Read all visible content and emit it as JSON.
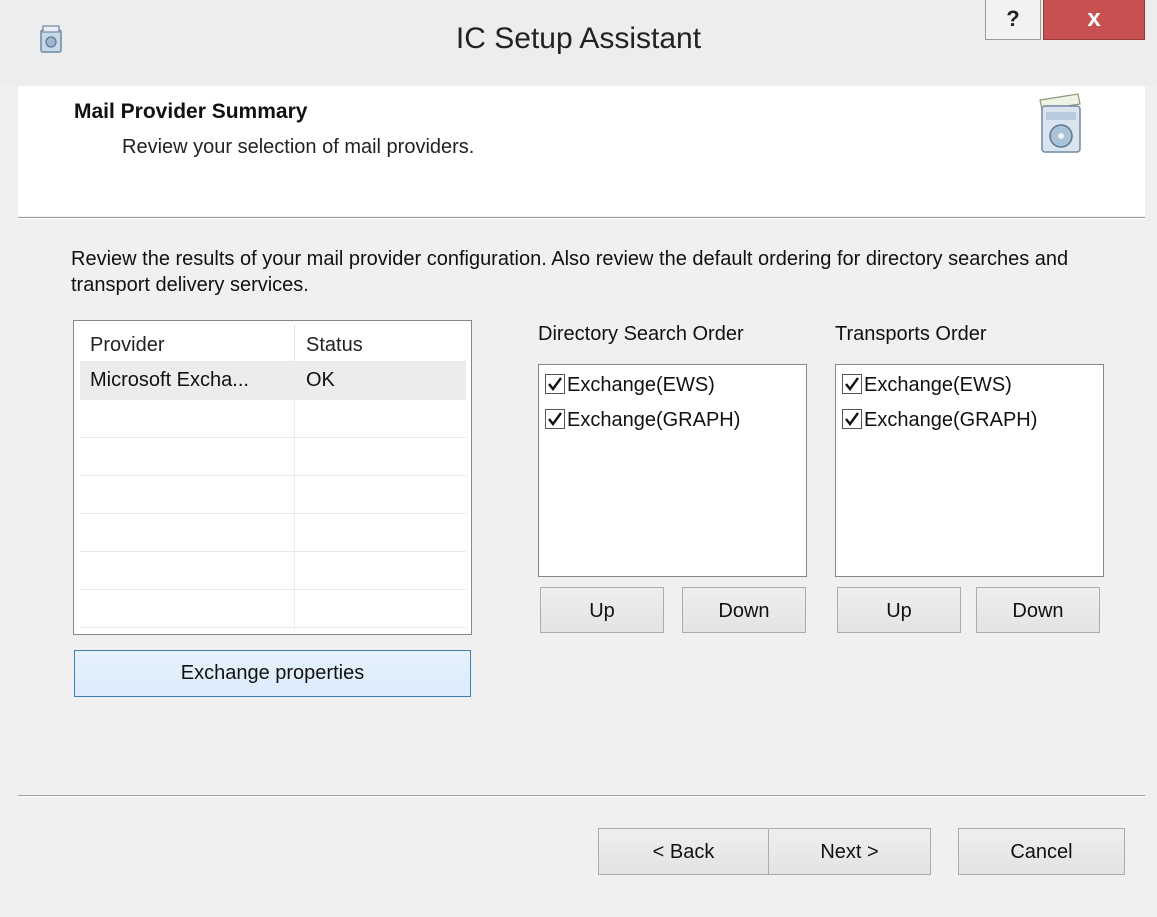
{
  "window": {
    "title": "IC Setup Assistant",
    "help_label": "?",
    "close_label": "x"
  },
  "header": {
    "title": "Mail Provider Summary",
    "subtitle": "Review your selection of mail providers."
  },
  "body": {
    "description": "Review the results of your mail provider configuration. Also review the default ordering for directory searches and transport delivery services."
  },
  "providers": {
    "columns": [
      "Provider",
      "Status"
    ],
    "rows": [
      {
        "provider": "Microsoft Excha...",
        "status": "OK"
      }
    ],
    "exchange_properties_label": "Exchange properties"
  },
  "directory_search": {
    "label": "Directory Search Order",
    "items": [
      {
        "label": "Exchange(EWS)",
        "checked": true
      },
      {
        "label": "Exchange(GRAPH)",
        "checked": true
      }
    ],
    "up_label": "Up",
    "down_label": "Down"
  },
  "transports": {
    "label": "Transports Order",
    "items": [
      {
        "label": "Exchange(EWS)",
        "checked": true
      },
      {
        "label": "Exchange(GRAPH)",
        "checked": true
      }
    ],
    "up_label": "Up",
    "down_label": "Down"
  },
  "footer": {
    "back_label": "< Back",
    "next_label": "Next >",
    "cancel_label": "Cancel"
  },
  "colors": {
    "close_button": "#c75050",
    "window_bg": "#f0f0f0",
    "header_bg": "#ffffff"
  },
  "icons": {
    "app": "setup-app-icon",
    "header": "installer-box-icon"
  }
}
